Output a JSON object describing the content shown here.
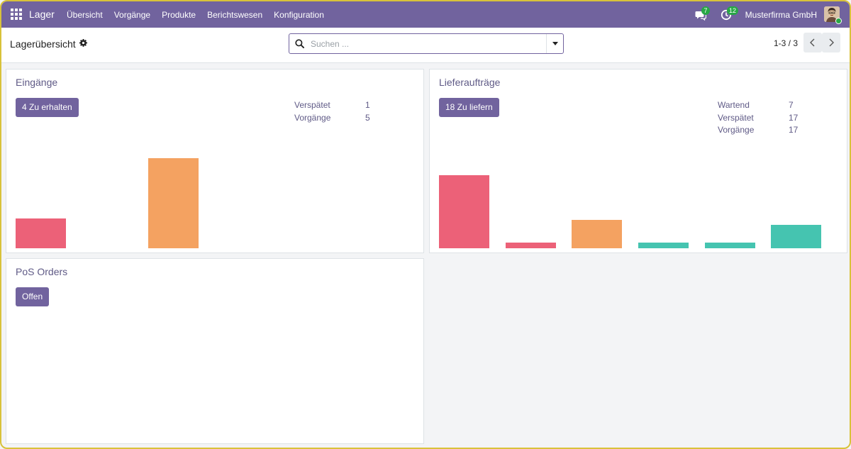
{
  "navbar": {
    "brand": "Lager",
    "menu": [
      "Übersicht",
      "Vorgänge",
      "Produkte",
      "Berichtswesen",
      "Konfiguration"
    ],
    "messages_badge": "7",
    "activities_badge": "12",
    "company": "Musterfirma GmbH",
    "accent": "#71639e"
  },
  "control": {
    "title": "Lagerübersicht",
    "search_placeholder": "Suchen ...",
    "pager_value": "1-3 / 3"
  },
  "cards": {
    "incoming": {
      "title": "Eingänge",
      "button": "4 Zu erhalten",
      "stats": [
        {
          "label": "Verspätet",
          "value": "1"
        },
        {
          "label": "Vorgänge",
          "value": "5"
        }
      ]
    },
    "delivery": {
      "title": "Lieferaufträge",
      "button": "18 Zu liefern",
      "stats": [
        {
          "label": "Wartend",
          "value": "7"
        },
        {
          "label": "Verspätet",
          "value": "17"
        },
        {
          "label": "Vorgänge",
          "value": "17"
        }
      ]
    },
    "pos": {
      "title": "PoS Orders",
      "button": "Offen"
    }
  },
  "chart_data": [
    {
      "type": "bar",
      "categories": [
        "",
        "",
        "",
        "",
        "",
        ""
      ],
      "values": [
        1,
        0,
        3,
        0,
        0,
        0
      ],
      "colors": [
        "#ec6178",
        "#ec6178",
        "#f4a261",
        "#45c4b0",
        "#45c4b0",
        "#45c4b0"
      ],
      "ylim": [
        0,
        3.3
      ]
    },
    {
      "type": "bar",
      "categories": [
        "",
        "",
        "",
        "",
        "",
        ""
      ],
      "values": [
        14,
        1,
        5.5,
        1,
        1,
        4.5
      ],
      "colors": [
        "#ec6178",
        "#ec6178",
        "#f4a261",
        "#45c4b0",
        "#45c4b0",
        "#45c4b0"
      ],
      "ylim": [
        0,
        17
      ]
    }
  ]
}
